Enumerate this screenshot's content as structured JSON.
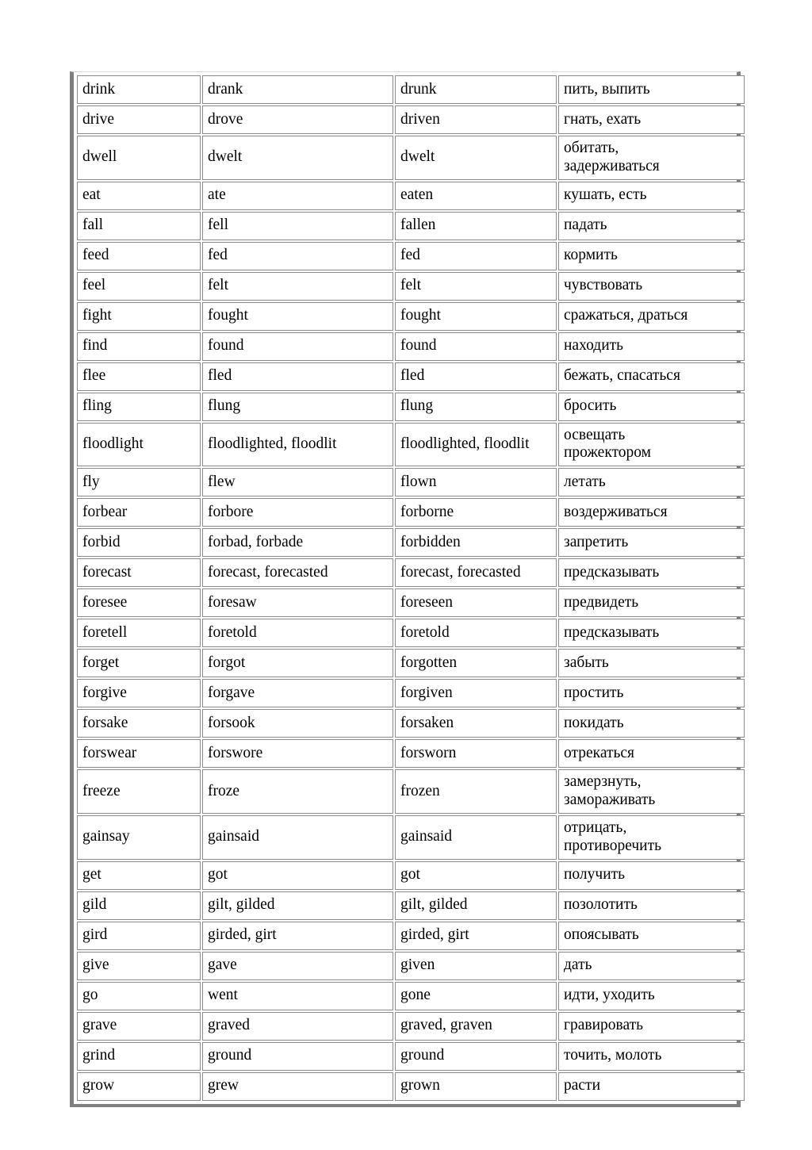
{
  "document": {
    "type": "irregular-verbs-table",
    "columns": [
      "infinitive",
      "past-simple",
      "past-participle",
      "translation"
    ],
    "frame_color": "#7f7f7f",
    "cell_border_color": "#8a8a8a",
    "text_color": "#000000",
    "background_color": "#ffffff"
  },
  "rows": [
    {
      "infinitive": "drink",
      "past": "drank",
      "participle": "drunk",
      "translation": "пить, выпить",
      "tall": false
    },
    {
      "infinitive": "drive",
      "past": "drove",
      "participle": "driven",
      "translation": "гнать, ехать",
      "tall": false
    },
    {
      "infinitive": "dwell",
      "past": "dwelt",
      "participle": "dwelt",
      "translation": "обитать,\nзадерживаться",
      "tall": true
    },
    {
      "infinitive": "eat",
      "past": "ate",
      "participle": "eaten",
      "translation": "кушать, есть",
      "tall": false
    },
    {
      "infinitive": "fall",
      "past": "fell",
      "participle": "fallen",
      "translation": "падать",
      "tall": false
    },
    {
      "infinitive": "feed",
      "past": "fed",
      "participle": "fed",
      "translation": "кормить",
      "tall": false
    },
    {
      "infinitive": "feel",
      "past": "felt",
      "participle": "felt",
      "translation": "чувствовать",
      "tall": false
    },
    {
      "infinitive": "fight",
      "past": "fought",
      "participle": "fought",
      "translation": "сражаться, драться",
      "tall": false
    },
    {
      "infinitive": "find",
      "past": "found",
      "participle": "found",
      "translation": "находить",
      "tall": false
    },
    {
      "infinitive": "flee",
      "past": "fled",
      "participle": "fled",
      "translation": "бежать, спасаться",
      "tall": false
    },
    {
      "infinitive": "fling",
      "past": "flung",
      "participle": "flung",
      "translation": "бросить",
      "tall": false
    },
    {
      "infinitive": "floodlight",
      "past": "floodlighted, floodlit",
      "participle": "floodlighted, floodlit",
      "translation": "освещать\nпрожектором",
      "tall": true
    },
    {
      "infinitive": "fly",
      "past": "flew",
      "participle": "flown",
      "translation": "летать",
      "tall": false
    },
    {
      "infinitive": "forbear",
      "past": "forbore",
      "participle": "forborne",
      "translation": "воздерживаться",
      "tall": false
    },
    {
      "infinitive": "forbid",
      "past": "forbad, forbade",
      "participle": "forbidden",
      "translation": "запретить",
      "tall": false
    },
    {
      "infinitive": "forecast",
      "past": "forecast, forecasted",
      "participle": "forecast, forecasted",
      "translation": "предсказывать",
      "tall": false
    },
    {
      "infinitive": "foresee",
      "past": "foresaw",
      "participle": "foreseen",
      "translation": "предвидеть",
      "tall": false
    },
    {
      "infinitive": "foretell",
      "past": "foretold",
      "participle": "foretold",
      "translation": "предсказывать",
      "tall": false
    },
    {
      "infinitive": "forget",
      "past": "forgot",
      "participle": "forgotten",
      "translation": "забыть",
      "tall": false
    },
    {
      "infinitive": "forgive",
      "past": "forgave",
      "participle": "forgiven",
      "translation": "простить",
      "tall": false
    },
    {
      "infinitive": "forsake",
      "past": "forsook",
      "participle": "forsaken",
      "translation": "покидать",
      "tall": false
    },
    {
      "infinitive": "forswear",
      "past": "forswore",
      "participle": "forsworn",
      "translation": "отрекаться",
      "tall": false
    },
    {
      "infinitive": "freeze",
      "past": "froze",
      "participle": "frozen",
      "translation": "замерзнуть,\nзамораживать",
      "tall": true
    },
    {
      "infinitive": "gainsay",
      "past": "gainsaid",
      "participle": "gainsaid",
      "translation": "отрицать,\nпротиворечить",
      "tall": true
    },
    {
      "infinitive": "get",
      "past": "got",
      "participle": "got",
      "translation": "получить",
      "tall": false
    },
    {
      "infinitive": "gild",
      "past": "gilt, gilded",
      "participle": "gilt, gilded",
      "translation": "позолотить",
      "tall": false
    },
    {
      "infinitive": "gird",
      "past": "girded, girt",
      "participle": "girded, girt",
      "translation": "опоясывать",
      "tall": false
    },
    {
      "infinitive": "give",
      "past": "gave",
      "participle": "given",
      "translation": "дать",
      "tall": false
    },
    {
      "infinitive": "go",
      "past": "went",
      "participle": "gone",
      "translation": "идти, уходить",
      "tall": false
    },
    {
      "infinitive": "grave",
      "past": "graved",
      "participle": "graved, graven",
      "translation": "гравировать",
      "tall": false
    },
    {
      "infinitive": "grind",
      "past": "ground",
      "participle": "ground",
      "translation": "точить, молоть",
      "tall": false
    },
    {
      "infinitive": "grow",
      "past": "grew",
      "participle": "grown",
      "translation": "расти",
      "tall": false
    }
  ]
}
